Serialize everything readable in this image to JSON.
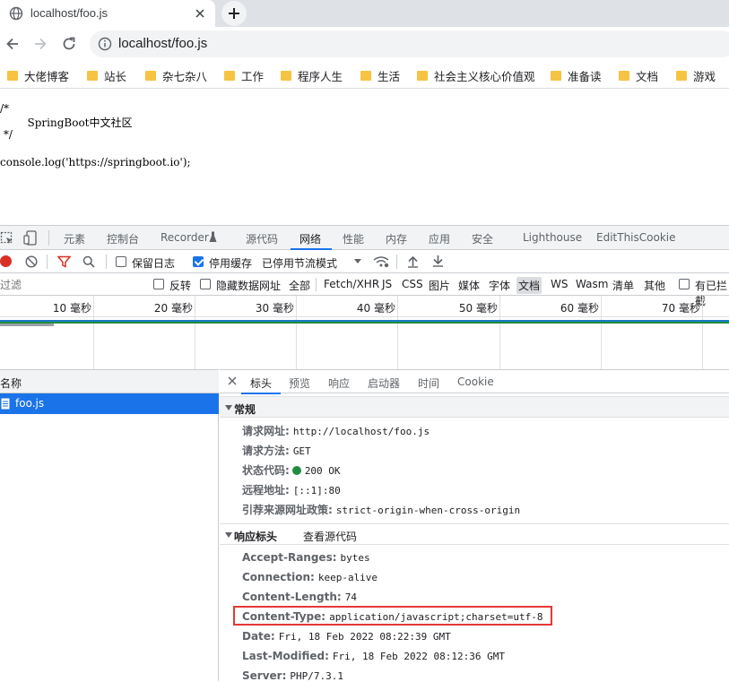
{
  "browser": {
    "tab_title": "localhost/foo.js",
    "url": "localhost/foo.js",
    "bookmarks": [
      "大佬博客",
      "站长",
      "杂七杂八",
      "工作",
      "程序人生",
      "生活",
      "社会主义核心价值观",
      "准备读",
      "文档",
      "游戏"
    ]
  },
  "page": {
    "lines": [
      "/*",
      "        SpringBoot中文社区",
      " */",
      "",
      "console.log('https://springboot.io');"
    ]
  },
  "devtools": {
    "tabs": [
      "元素",
      "控制台",
      "Recorder",
      "源代码",
      "网络",
      "性能",
      "内存",
      "应用",
      "安全",
      "Lighthouse",
      "EditThisCookie"
    ],
    "active_tab": "网络",
    "network_toolbar": {
      "preserve_log": "保留日志",
      "disable_cache": "停用缓存",
      "throttling": "已停用节流模式"
    },
    "filter_bar": {
      "placeholder": "过滤",
      "invert": "反转",
      "hide_data_urls": "隐藏数据网址",
      "types": [
        "全部",
        "Fetch/XHR",
        "JS",
        "CSS",
        "图片",
        "媒体",
        "字体",
        "文档",
        "WS",
        "Wasm",
        "清单",
        "其他"
      ],
      "active_type": "文档",
      "blocked_cookies": "有已拦截"
    },
    "timeline_ticks": [
      "10 毫秒",
      "20 毫秒",
      "30 毫秒",
      "40 毫秒",
      "50 毫秒",
      "60 毫秒",
      "70 毫秒"
    ],
    "requests": {
      "header": "名称",
      "items": [
        "foo.js"
      ]
    },
    "detail_tabs": [
      "标头",
      "预览",
      "响应",
      "启动器",
      "时间",
      "Cookie"
    ],
    "active_detail_tab": "标头",
    "general": {
      "title": "常规",
      "rows": [
        {
          "key": "请求网址:",
          "value": "http://localhost/foo.js"
        },
        {
          "key": "请求方法:",
          "value": "GET"
        },
        {
          "key": "状态代码:",
          "value": "200 OK"
        },
        {
          "key": "远程地址:",
          "value": "[::1]:80"
        },
        {
          "key": "引荐来源网址政策:",
          "value": "strict-origin-when-cross-origin"
        }
      ]
    },
    "response_headers": {
      "title": "响应标头",
      "view_source": "查看源代码",
      "rows": [
        {
          "key": "Accept-Ranges:",
          "value": "bytes"
        },
        {
          "key": "Connection:",
          "value": "keep-alive"
        },
        {
          "key": "Content-Length:",
          "value": "74"
        },
        {
          "key": "Content-Type:",
          "value": "application/javascript;charset=utf-8"
        },
        {
          "key": "Date:",
          "value": "Fri, 18 Feb 2022 08:22:39 GMT"
        },
        {
          "key": "Last-Modified:",
          "value": "Fri, 18 Feb 2022 08:12:36 GMT"
        },
        {
          "key": "Server:",
          "value": "PHP/7.3.1"
        }
      ]
    }
  },
  "colors": {
    "accent": "#1a73e8",
    "status_ok": "#1e8e3e",
    "highlight_box": "#e53935",
    "record": "#d93025"
  }
}
